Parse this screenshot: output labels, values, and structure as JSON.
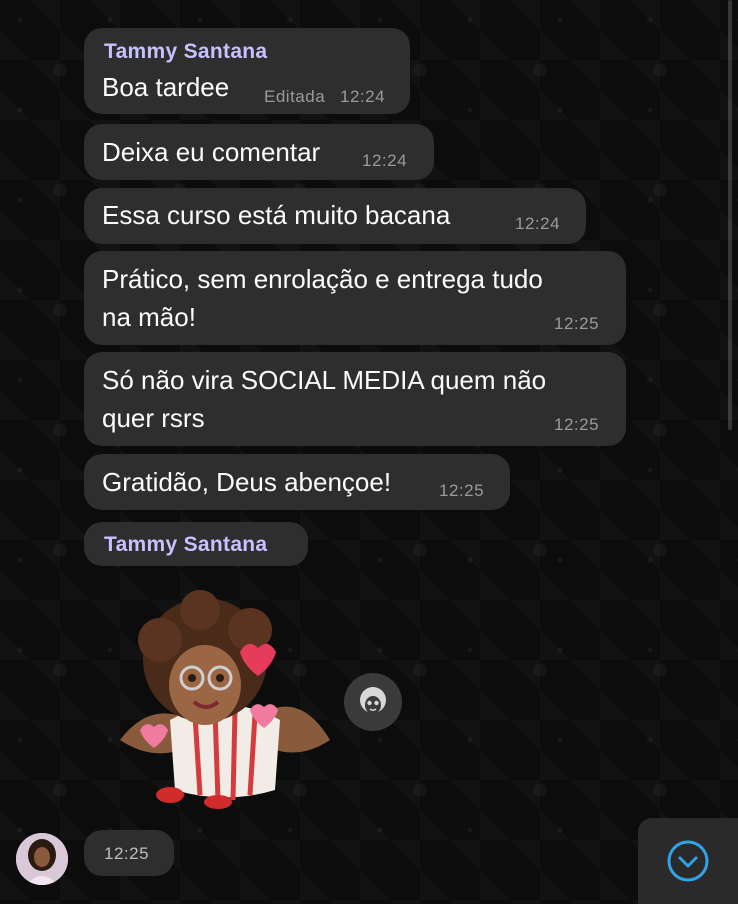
{
  "chat": {
    "sender_name": "Tammy Santana",
    "messages": [
      {
        "text": "Boa tardee",
        "edited_label": "Editada",
        "time": "12:24"
      },
      {
        "text": "Deixa eu comentar",
        "time": "12:24"
      },
      {
        "text": "Essa curso está muito bacana",
        "time": "12:24"
      },
      {
        "text": "Prático, sem enrolação e entrega tudo\nna mão!",
        "time": "12:25"
      },
      {
        "text": "Só não vira SOCIAL MEDIA quem não\nquer rsrs",
        "time": "12:25"
      },
      {
        "text": "Gratidão, Deus abençoe!",
        "time": "12:25"
      }
    ],
    "sticker_sender_name": "Tammy Santana",
    "sticker_time": "12:25"
  },
  "icons": {
    "react": "avatar-face-icon",
    "scroll_down": "chevron-down-circle-icon"
  },
  "colors": {
    "background": "#0b0b0b",
    "bubble": "#2e2e2e",
    "sender": "#c8c1ff",
    "accent": "#2fa4e7"
  }
}
